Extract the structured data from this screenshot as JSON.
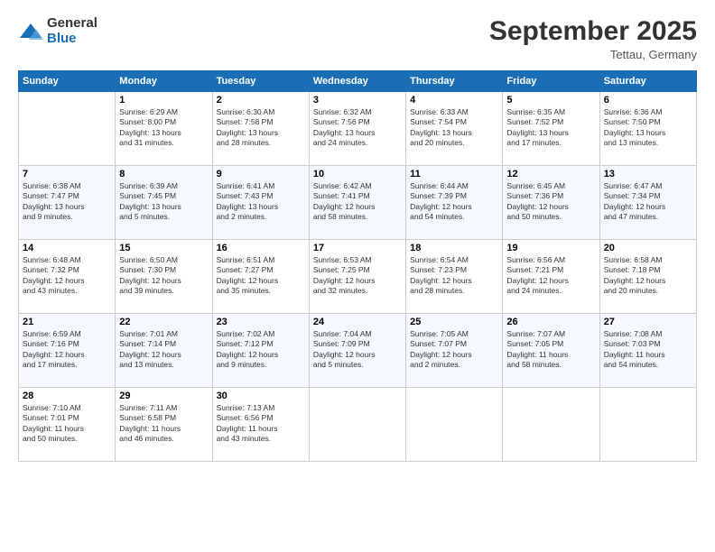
{
  "logo": {
    "general": "General",
    "blue": "Blue"
  },
  "title": "September 2025",
  "location": "Tettau, Germany",
  "weekdays": [
    "Sunday",
    "Monday",
    "Tuesday",
    "Wednesday",
    "Thursday",
    "Friday",
    "Saturday"
  ],
  "weeks": [
    [
      {
        "day": "",
        "info": ""
      },
      {
        "day": "1",
        "info": "Sunrise: 6:29 AM\nSunset: 8:00 PM\nDaylight: 13 hours\nand 31 minutes."
      },
      {
        "day": "2",
        "info": "Sunrise: 6:30 AM\nSunset: 7:58 PM\nDaylight: 13 hours\nand 28 minutes."
      },
      {
        "day": "3",
        "info": "Sunrise: 6:32 AM\nSunset: 7:56 PM\nDaylight: 13 hours\nand 24 minutes."
      },
      {
        "day": "4",
        "info": "Sunrise: 6:33 AM\nSunset: 7:54 PM\nDaylight: 13 hours\nand 20 minutes."
      },
      {
        "day": "5",
        "info": "Sunrise: 6:35 AM\nSunset: 7:52 PM\nDaylight: 13 hours\nand 17 minutes."
      },
      {
        "day": "6",
        "info": "Sunrise: 6:36 AM\nSunset: 7:50 PM\nDaylight: 13 hours\nand 13 minutes."
      }
    ],
    [
      {
        "day": "7",
        "info": "Sunrise: 6:38 AM\nSunset: 7:47 PM\nDaylight: 13 hours\nand 9 minutes."
      },
      {
        "day": "8",
        "info": "Sunrise: 6:39 AM\nSunset: 7:45 PM\nDaylight: 13 hours\nand 5 minutes."
      },
      {
        "day": "9",
        "info": "Sunrise: 6:41 AM\nSunset: 7:43 PM\nDaylight: 13 hours\nand 2 minutes."
      },
      {
        "day": "10",
        "info": "Sunrise: 6:42 AM\nSunset: 7:41 PM\nDaylight: 12 hours\nand 58 minutes."
      },
      {
        "day": "11",
        "info": "Sunrise: 6:44 AM\nSunset: 7:39 PM\nDaylight: 12 hours\nand 54 minutes."
      },
      {
        "day": "12",
        "info": "Sunrise: 6:45 AM\nSunset: 7:36 PM\nDaylight: 12 hours\nand 50 minutes."
      },
      {
        "day": "13",
        "info": "Sunrise: 6:47 AM\nSunset: 7:34 PM\nDaylight: 12 hours\nand 47 minutes."
      }
    ],
    [
      {
        "day": "14",
        "info": "Sunrise: 6:48 AM\nSunset: 7:32 PM\nDaylight: 12 hours\nand 43 minutes."
      },
      {
        "day": "15",
        "info": "Sunrise: 6:50 AM\nSunset: 7:30 PM\nDaylight: 12 hours\nand 39 minutes."
      },
      {
        "day": "16",
        "info": "Sunrise: 6:51 AM\nSunset: 7:27 PM\nDaylight: 12 hours\nand 35 minutes."
      },
      {
        "day": "17",
        "info": "Sunrise: 6:53 AM\nSunset: 7:25 PM\nDaylight: 12 hours\nand 32 minutes."
      },
      {
        "day": "18",
        "info": "Sunrise: 6:54 AM\nSunset: 7:23 PM\nDaylight: 12 hours\nand 28 minutes."
      },
      {
        "day": "19",
        "info": "Sunrise: 6:56 AM\nSunset: 7:21 PM\nDaylight: 12 hours\nand 24 minutes."
      },
      {
        "day": "20",
        "info": "Sunrise: 6:58 AM\nSunset: 7:18 PM\nDaylight: 12 hours\nand 20 minutes."
      }
    ],
    [
      {
        "day": "21",
        "info": "Sunrise: 6:59 AM\nSunset: 7:16 PM\nDaylight: 12 hours\nand 17 minutes."
      },
      {
        "day": "22",
        "info": "Sunrise: 7:01 AM\nSunset: 7:14 PM\nDaylight: 12 hours\nand 13 minutes."
      },
      {
        "day": "23",
        "info": "Sunrise: 7:02 AM\nSunset: 7:12 PM\nDaylight: 12 hours\nand 9 minutes."
      },
      {
        "day": "24",
        "info": "Sunrise: 7:04 AM\nSunset: 7:09 PM\nDaylight: 12 hours\nand 5 minutes."
      },
      {
        "day": "25",
        "info": "Sunrise: 7:05 AM\nSunset: 7:07 PM\nDaylight: 12 hours\nand 2 minutes."
      },
      {
        "day": "26",
        "info": "Sunrise: 7:07 AM\nSunset: 7:05 PM\nDaylight: 11 hours\nand 58 minutes."
      },
      {
        "day": "27",
        "info": "Sunrise: 7:08 AM\nSunset: 7:03 PM\nDaylight: 11 hours\nand 54 minutes."
      }
    ],
    [
      {
        "day": "28",
        "info": "Sunrise: 7:10 AM\nSunset: 7:01 PM\nDaylight: 11 hours\nand 50 minutes."
      },
      {
        "day": "29",
        "info": "Sunrise: 7:11 AM\nSunset: 6:58 PM\nDaylight: 11 hours\nand 46 minutes."
      },
      {
        "day": "30",
        "info": "Sunrise: 7:13 AM\nSunset: 6:56 PM\nDaylight: 11 hours\nand 43 minutes."
      },
      {
        "day": "",
        "info": ""
      },
      {
        "day": "",
        "info": ""
      },
      {
        "day": "",
        "info": ""
      },
      {
        "day": "",
        "info": ""
      }
    ]
  ]
}
